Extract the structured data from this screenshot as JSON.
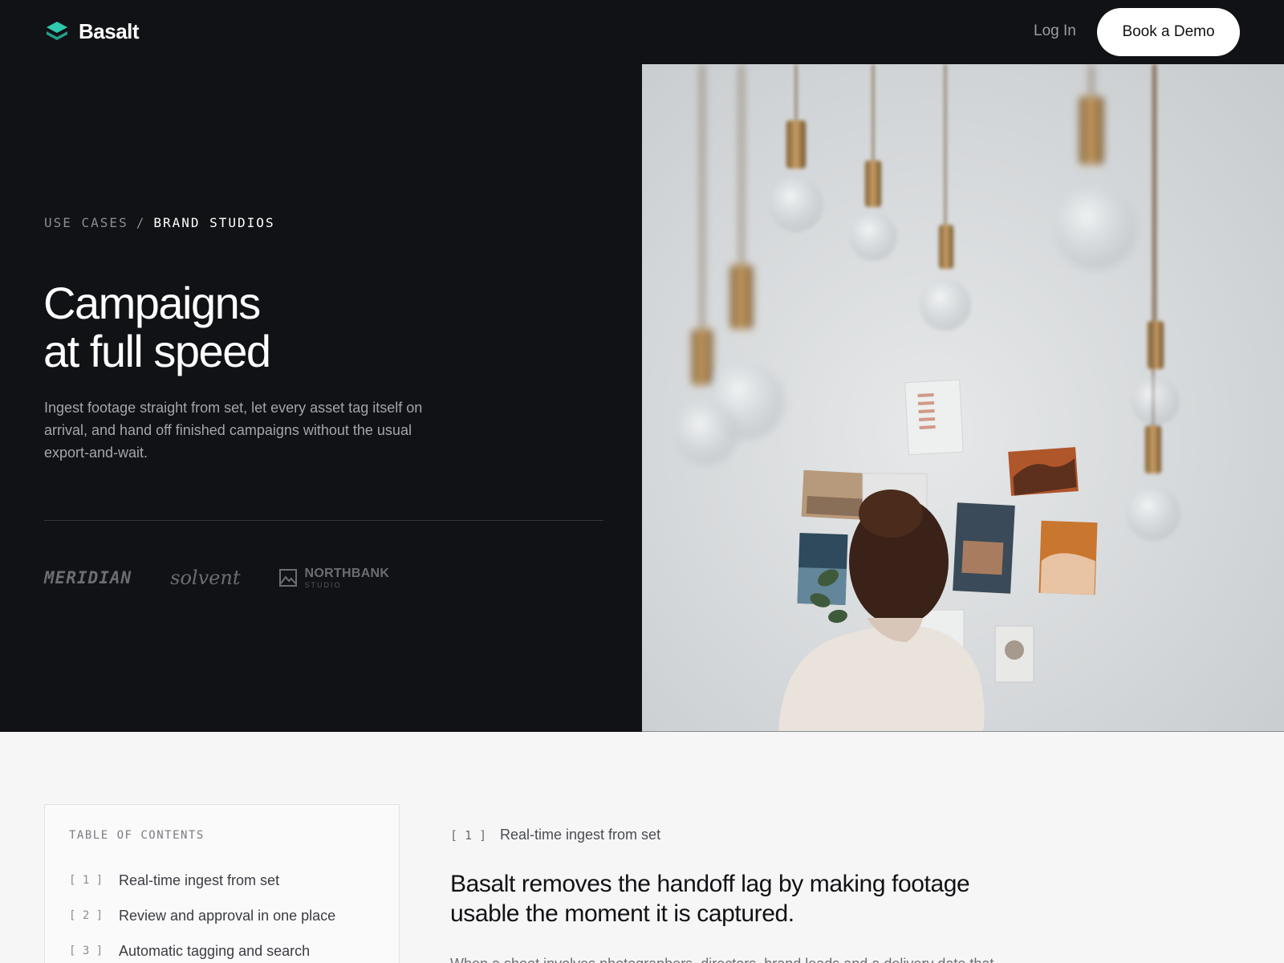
{
  "header": {
    "brand_name": "Basalt",
    "brand_color": "#2fc9b0",
    "login_label": "Log In",
    "demo_label": "Book a Demo"
  },
  "hero": {
    "breadcrumb": {
      "parent": "USE CASES",
      "separator": "/",
      "current": "BRAND STUDIOS"
    },
    "title_line1": "Campaigns",
    "title_line2": "at full speed",
    "description": "Ingest footage straight from set, let every asset tag itself on arrival, and hand off finished campaigns without the usual export-and-wait.",
    "client_logos": {
      "meridian": "MERIDIAN",
      "solvent": "solvent",
      "northbank": "NORTHBANK",
      "northbank_sub": "STUDIO"
    },
    "photo_alt": "Woman looking at a wall of pinned photos beneath hanging bulbs"
  },
  "toc": {
    "heading": "TABLE OF CONTENTS",
    "items": [
      {
        "num": "[ 1 ]",
        "label": "Real-time ingest from set"
      },
      {
        "num": "[ 2 ]",
        "label": "Review and approval in one place"
      },
      {
        "num": "[ 3 ]",
        "label": "Automatic tagging and search"
      }
    ]
  },
  "section": {
    "num": "[ 1 ]",
    "eyebrow": "Real-time ingest from set",
    "title": "Basalt removes the handoff lag by making footage usable the moment it is captured.",
    "body": "When a shoot involves photographers, directors, brand leads and a delivery date that"
  }
}
